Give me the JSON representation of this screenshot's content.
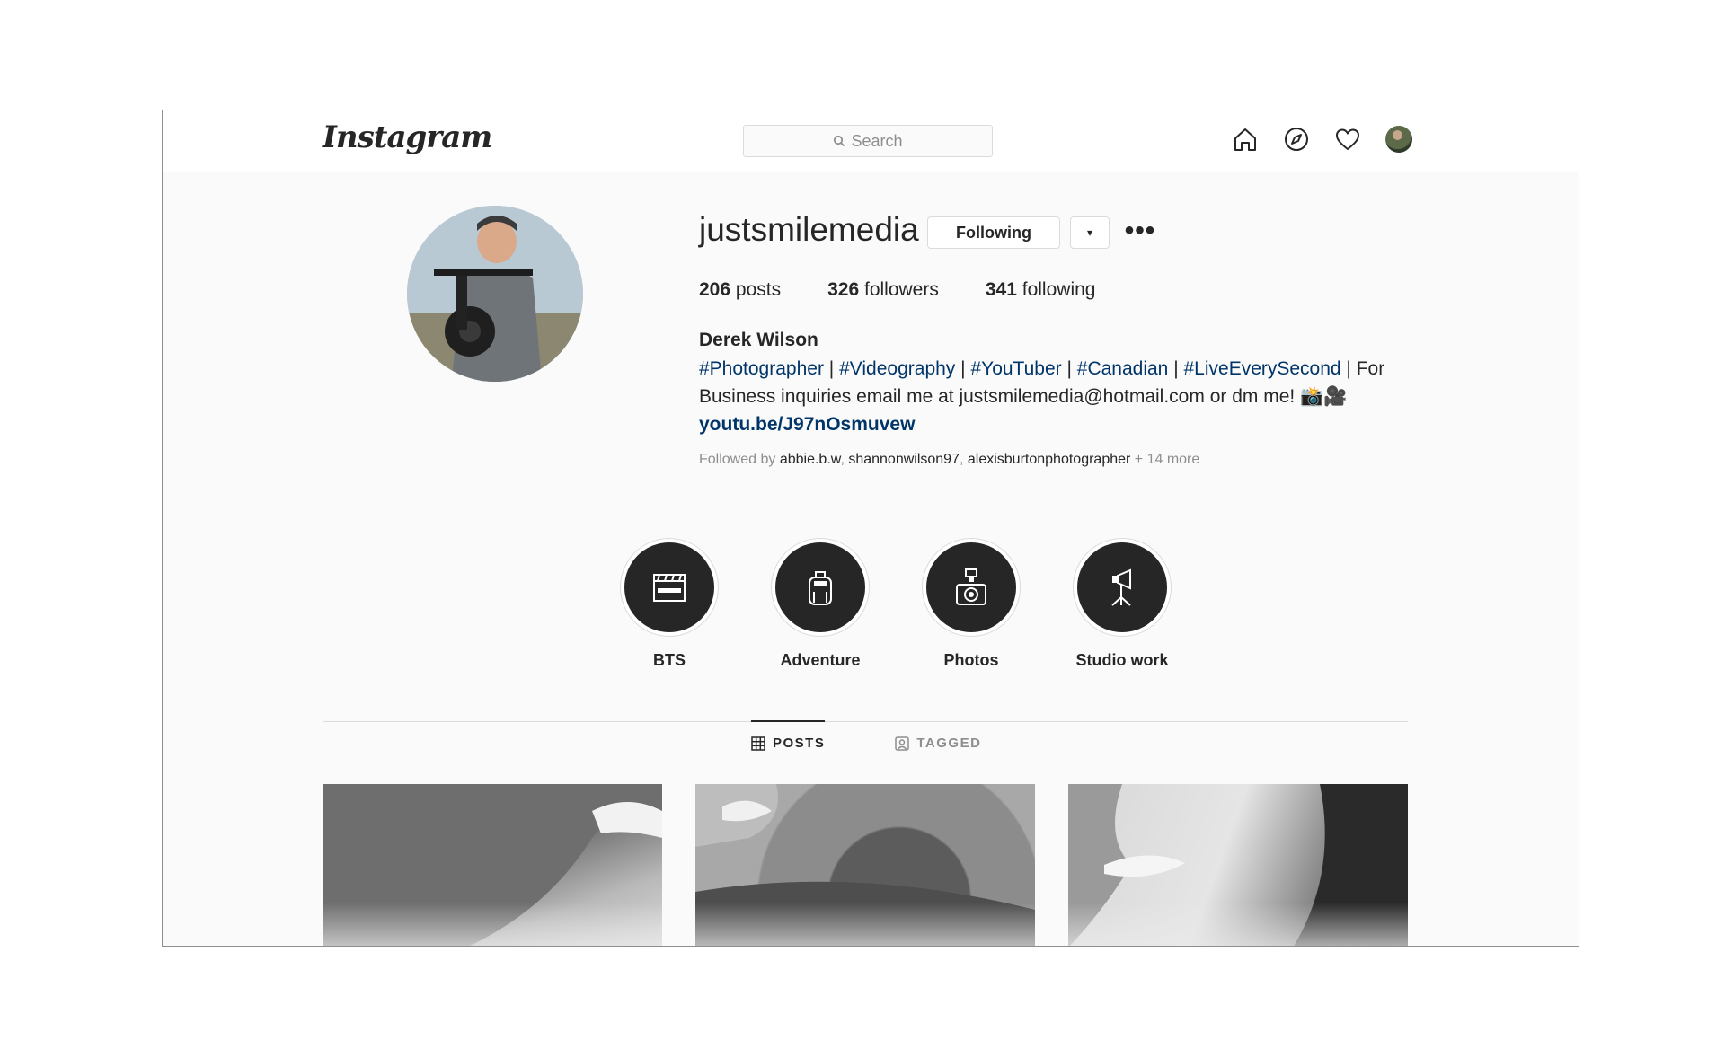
{
  "topbar": {
    "logo": "Instagram",
    "search_placeholder": "Search",
    "icons": [
      "home-icon",
      "explore-icon",
      "heart-icon",
      "profile-avatar"
    ]
  },
  "profile": {
    "username": "justsmilemedia",
    "following_label": "Following",
    "dropdown_icon": "▾",
    "more_icon": "•••",
    "stats": {
      "posts_count": "206",
      "posts_label": "posts",
      "followers_count": "326",
      "followers_label": "followers",
      "following_count": "341",
      "following_label": "following"
    },
    "full_name": "Derek Wilson",
    "bio": {
      "tag1": "#Photographer",
      "sep1": " | ",
      "tag2": "#Videography",
      "sep2": " | ",
      "tag3": "#YouTuber",
      "sep3": " | ",
      "tag4": "#Canadian",
      "sep4": " | ",
      "tag5": "#LiveEverySecond",
      "text": " | For Business inquiries email me at justsmilemedia@hotmail.com or dm me! 📸🎥",
      "link": "youtu.be/J97nOsmuvew"
    },
    "followed_by": {
      "prefix": "Followed by ",
      "user1": "abbie.b.w",
      "sep1": ", ",
      "user2": "shannonwilson97",
      "sep2": ", ",
      "user3": "alexisburtonphotographer",
      "suffix": " + 14 more"
    }
  },
  "highlights": [
    {
      "label": "BTS",
      "icon": "clapperboard-icon"
    },
    {
      "label": "Adventure",
      "icon": "backpack-icon"
    },
    {
      "label": "Photos",
      "icon": "camera-flash-icon"
    },
    {
      "label": "Studio work",
      "icon": "studio-light-icon"
    }
  ],
  "tabs": {
    "posts": "POSTS",
    "tagged": "TAGGED"
  },
  "colors": {
    "hashtag": "#003569",
    "text": "#262626",
    "muted": "#8e8e8e",
    "border": "#dbdbdb"
  }
}
